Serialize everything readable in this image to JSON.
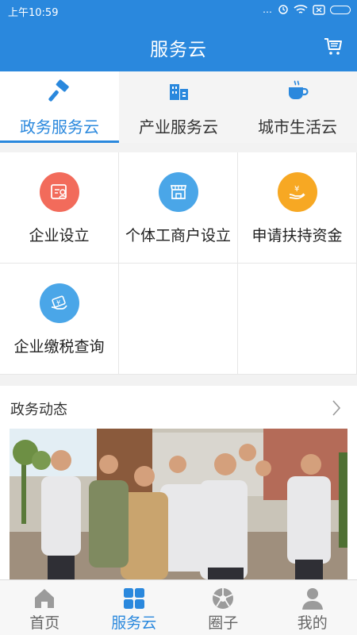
{
  "status": {
    "time": "上午10:59",
    "dots": "…"
  },
  "header": {
    "title": "服务云"
  },
  "tabs": [
    {
      "label": "政务服务云",
      "active": true,
      "icon": "hammer-icon"
    },
    {
      "label": "产业服务云",
      "active": false,
      "icon": "buildings-icon"
    },
    {
      "label": "城市生活云",
      "active": false,
      "icon": "coffee-cup-icon"
    }
  ],
  "services": [
    {
      "label": "企业设立",
      "icon": "id-card-icon",
      "color": "#f26b5b"
    },
    {
      "label": "个体工商户设立",
      "icon": "storefront-icon",
      "color": "#4aa6e8"
    },
    {
      "label": "申请扶持资金",
      "icon": "hand-coin-icon",
      "color": "#f7a823"
    },
    {
      "label": "企业缴税查询",
      "icon": "tax-card-icon",
      "color": "#4aa6e8"
    }
  ],
  "news": {
    "heading": "政务动态"
  },
  "bottom_nav": [
    {
      "label": "首页",
      "icon": "home-icon",
      "active": false
    },
    {
      "label": "服务云",
      "icon": "grid-icon",
      "active": true
    },
    {
      "label": "圈子",
      "icon": "aperture-icon",
      "active": false
    },
    {
      "label": "我的",
      "icon": "user-icon",
      "active": false
    }
  ],
  "colors": {
    "primary": "#2a88dd",
    "inactive_icon": "#9b9b9b"
  }
}
